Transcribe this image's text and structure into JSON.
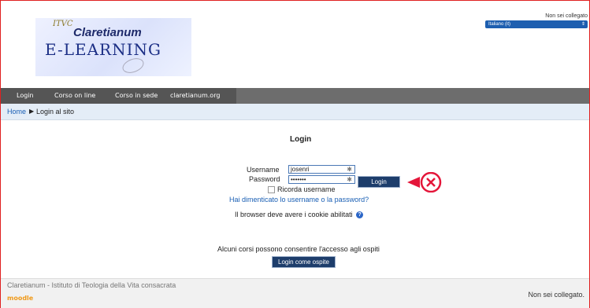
{
  "header": {
    "logo": {
      "line1": "ITVC",
      "line2": "Claretianum",
      "line3": "E-LEARNING"
    },
    "login_status": "Non sei collegato",
    "language": "Italiano (it)"
  },
  "nav": {
    "items": [
      {
        "label": "Login"
      },
      {
        "label": "Corso on line"
      },
      {
        "label": "Corso in sede"
      },
      {
        "label": "claretianum.org"
      }
    ]
  },
  "breadcrumb": {
    "home": "Home",
    "separator": "▶",
    "current": "Login al sito"
  },
  "login": {
    "heading": "Login",
    "username_label": "Username",
    "username_value": "josenri",
    "password_label": "Password",
    "password_value": "•••••••",
    "submit_label": "Login",
    "remember_label": "Ricorda username",
    "forgot_link": "Hai dimenticato lo username o la password?",
    "cookies_text": "Il browser deve avere i cookie abilitati",
    "guests_text": "Alcuni corsi possono consentire l'accesso agli ospiti",
    "guest_button": "Login come ospite"
  },
  "footer": {
    "institution": "Claretianum - Istituto di Teologia della Vita consacrata",
    "moodle": "moodle",
    "status": "Non sei collegato."
  },
  "colors": {
    "nav_bg": "#6d6d6d",
    "button_bg": "#1d3d6b",
    "link": "#1a5fb4",
    "marker": "#e4163a"
  }
}
